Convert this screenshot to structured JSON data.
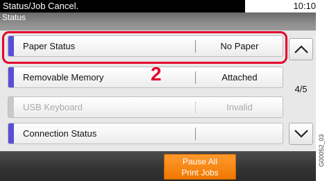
{
  "header": {
    "title": "Status/Job Cancel.",
    "time": "10:10",
    "subtitle": "Status"
  },
  "rows": [
    {
      "label": "Paper Status",
      "value": "No Paper",
      "enabled": true
    },
    {
      "label": "Removable Memory",
      "value": "Attached",
      "enabled": true
    },
    {
      "label": "USB Keyboard",
      "value": "Invalid",
      "enabled": false
    },
    {
      "label": "Connection Status",
      "value": "",
      "enabled": true
    }
  ],
  "pagination": {
    "indicator": "4/5"
  },
  "callout": {
    "step": "2"
  },
  "footer": {
    "pause_line1": "Pause All",
    "pause_line2": "Print Jobs"
  },
  "figure_code": "G00052_03",
  "colors": {
    "accent": "#5a4fd6",
    "highlight": "#e4002b",
    "pause_button": "#f07800"
  },
  "icons": {
    "scroll_up": "chevron-up-icon",
    "scroll_down": "chevron-down-icon"
  }
}
